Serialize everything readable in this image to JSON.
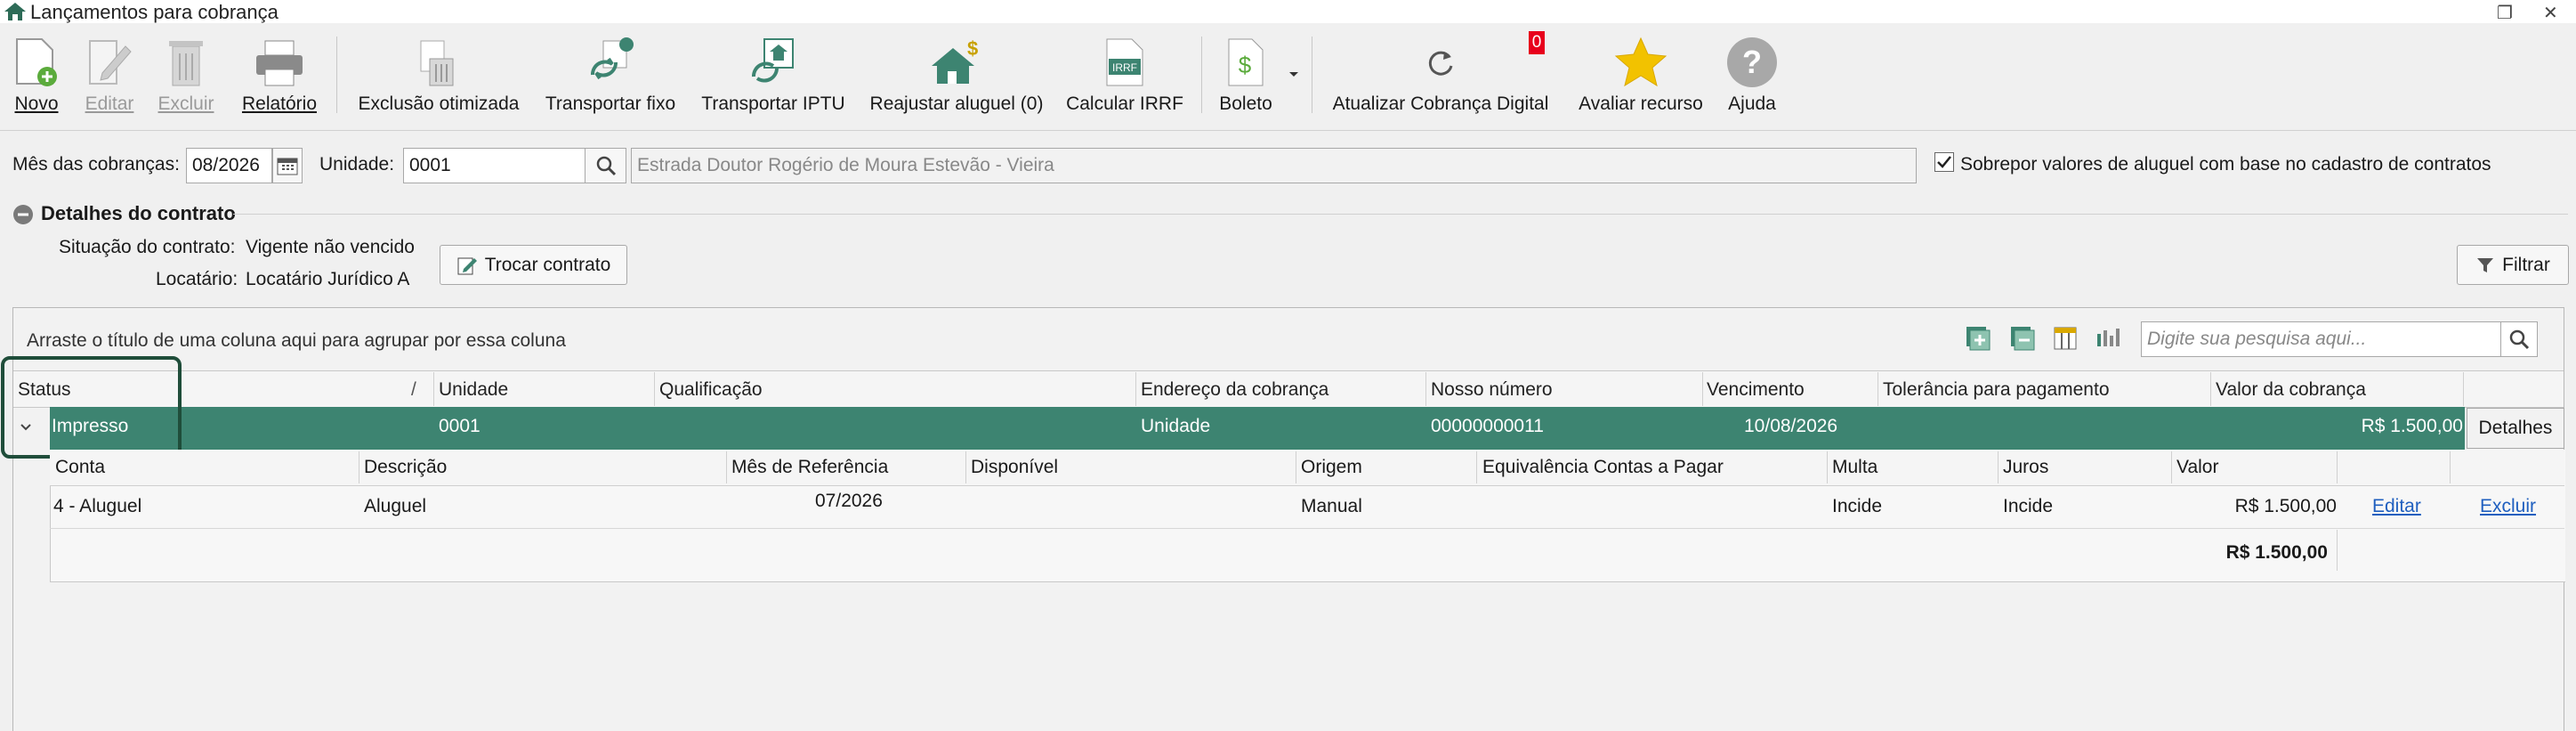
{
  "window": {
    "title": "Lançamentos para cobrança"
  },
  "toolbar": {
    "buttons": [
      {
        "label": "Novo",
        "icon": "new-document-icon"
      },
      {
        "label": "Editar",
        "icon": "edit-icon"
      },
      {
        "label": "Excluir",
        "icon": "trash-icon"
      },
      {
        "label": "Relatório",
        "icon": "printer-icon"
      },
      {
        "label": "Exclusão otimizada",
        "icon": "optimized-delete-icon"
      },
      {
        "label": "Transportar fixo",
        "icon": "transport-fixed-icon"
      },
      {
        "label": "Transportar IPTU",
        "icon": "transport-iptu-icon"
      },
      {
        "label": "Reajustar aluguel (0)",
        "icon": "readjust-rent-icon"
      },
      {
        "label": "Calcular IRRF",
        "icon": "irrf-icon"
      },
      {
        "label": "Boleto",
        "icon": "boleto-icon"
      },
      {
        "label": "Atualizar Cobrança Digital",
        "icon": "refresh-icon",
        "badge": "0"
      },
      {
        "label": "Avaliar recurso",
        "icon": "star-icon"
      },
      {
        "label": "Ajuda",
        "icon": "help-icon"
      }
    ],
    "irrf_icon_text": "IRRF"
  },
  "filters": {
    "month_label": "Mês das cobranças:",
    "month_value": "08/2026",
    "unit_label": "Unidade:",
    "unit_value": "0001",
    "address_value": "Estrada Doutor Rogério de Moura Estevão - Vieira",
    "override_label": "Sobrepor valores de aluguel com base no cadastro de contratos",
    "override_checked": true
  },
  "contract": {
    "section_title": "Detalhes do contrato",
    "status_label": "Situação do contrato:",
    "status_value": "Vigente não vencido",
    "tenant_label": "Locatário:",
    "tenant_value": "Locatário Jurídico A",
    "change_button": "Trocar contrato",
    "filter_button": "Filtrar"
  },
  "grid": {
    "group_hint": "Arraste o título de uma coluna aqui para agrupar por essa coluna",
    "search_placeholder": "Digite sua pesquisa aqui...",
    "columns": [
      "Status",
      "Unidade",
      "Qualificação",
      "Endereço da cobrança",
      "Nosso número",
      "Vencimento",
      "Tolerância para pagamento",
      "Valor da cobrança"
    ],
    "sort_marker": "/",
    "row": {
      "status": "Impresso",
      "unidade": "0001",
      "endereco": "Unidade",
      "nosso_numero": "00000000011",
      "vencimento": "10/08/2026",
      "valor": "R$ 1.500,00",
      "details_button": "Detalhes"
    },
    "detail": {
      "columns": [
        "Conta",
        "Descrição",
        "Mês de Referência",
        "Disponível",
        "Origem",
        "Equivalência Contas a Pagar",
        "Multa",
        "Juros",
        "Valor"
      ],
      "rows": [
        {
          "conta": "4 - Aluguel",
          "descricao": "Aluguel",
          "mes_referencia": "07/2026",
          "disponivel": "",
          "origem": "Manual",
          "equivalencia": "",
          "multa": "Incide",
          "juros": "Incide",
          "valor": "R$ 1.500,00",
          "edit_link": "Editar",
          "delete_link": "Excluir"
        }
      ],
      "total": "R$ 1.500,00"
    }
  },
  "colors": {
    "selected_row": "#3d8471",
    "highlight_border": "#1f4d3a",
    "link": "#1f5fbf",
    "badge": "#e8001c"
  }
}
